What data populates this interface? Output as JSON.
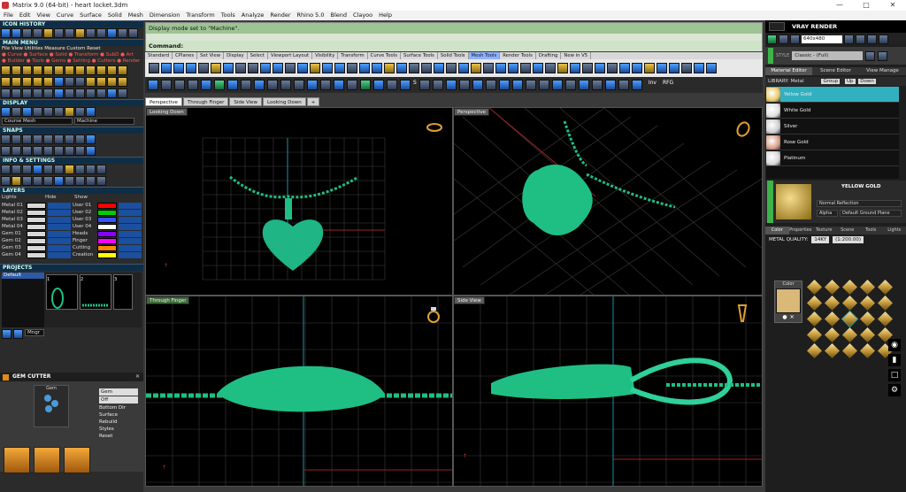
{
  "window": {
    "title": "Matrix 9.0 (64-bit) - heart locket.3dm"
  },
  "menu": [
    "File",
    "Edit",
    "View",
    "Curve",
    "Surface",
    "Solid",
    "Mesh",
    "Dimension",
    "Transform",
    "Tools",
    "Analyze",
    "Render",
    "Rhino 5.0",
    "Blend",
    "Clayoo",
    "Help"
  ],
  "left": {
    "icon_history": "ICON HISTORY",
    "main_menu": "MAIN MENU",
    "mm_row1": "File   View  Utilities  Measure  Custom        Reset",
    "mm_row2": "● Curve ● Surface ● Solid ● Transform ● SubD ● Art",
    "mm_row3": "● Builder ● Tools ● Gems ● Setting ● Cutters ● Render",
    "display": "DISPLAY",
    "display_mode_left": "Course Mesh",
    "display_mode_right": "Machine",
    "snaps": "SNAPS",
    "info_settings": "INFO & SETTINGS",
    "layers_title": "LAYERS",
    "lights": "Lights",
    "hide": "Hide",
    "show": "Show",
    "layers": [
      {
        "a": "Metal 01",
        "b": "User 01",
        "ca": "#d8d8d8",
        "cb": "#ff0000"
      },
      {
        "a": "Metal 02",
        "b": "User 02",
        "ca": "#d8d8d8",
        "cb": "#00cc00"
      },
      {
        "a": "Metal 03",
        "b": "User 03",
        "ca": "#d8d8d8",
        "cb": "#3355ff"
      },
      {
        "a": "Metal 04",
        "b": "User 04",
        "ca": "#d8d8d8",
        "cb": "#ffffff"
      },
      {
        "a": "Gem 01",
        "b": "Heads",
        "ca": "#d8d8d8",
        "cb": "#8800ff"
      },
      {
        "a": "Gem 02",
        "b": "Finger",
        "ca": "#d8d8d8",
        "cb": "#ff00ff"
      },
      {
        "a": "Gem 03",
        "b": "Cutting",
        "ca": "#d8d8d8",
        "cb": "#ff8800"
      },
      {
        "a": "Gem 04",
        "b": "Creation",
        "ca": "#d8d8d8",
        "cb": "#ffff00"
      }
    ],
    "projects": "PROJECTS",
    "project_default": "Default",
    "thumb1": "1",
    "thumb2": "2",
    "thumb3": "3",
    "mngr": "Mngr",
    "gem_cutter": "GEM CUTTER",
    "gem_label": "Gem",
    "gem_options": [
      "Gem",
      "Off",
      "Bottom Dir",
      "Surface",
      "Rebuild",
      "Styles",
      "Reset"
    ]
  },
  "command": {
    "line1": "Display mode set to \"Machine\".",
    "line2": "Command:"
  },
  "toolbar_tabs": [
    "Standard",
    "CPlanes",
    "Set View",
    "Display",
    "Select",
    "Viewport Layout",
    "Visibility",
    "Transform",
    "Curve Tools",
    "Surface Tools",
    "Solid Tools",
    "Mesh Tools",
    "Render Tools",
    "Drafting",
    "New in V5"
  ],
  "toolbar_tabs_active": "Mesh Tools",
  "toolbar2_text": {
    "s": "S",
    "inv": "Inv",
    "rfg": "RFG"
  },
  "viewport_tabs": [
    "Perspective",
    "Through Finger",
    "Side View",
    "Looking Down",
    "+"
  ],
  "viewports": {
    "top_left": "Looking Down",
    "top_right": "Perspective",
    "bottom_left": "Through Finger",
    "bottom_right": "Side View"
  },
  "vray": {
    "title": "VRAY RENDER",
    "resolution": "640x480",
    "style_label": "STYLE",
    "style_value": "Classic - (Full)",
    "tabs": [
      "Material Editor",
      "Scene Editor",
      "View Manage"
    ],
    "library": "LIBRARY: Metal",
    "library_controls": [
      "Group",
      "Up",
      "Down"
    ],
    "materials": [
      {
        "name": "Yellow Gold",
        "color": "#e8c96a"
      },
      {
        "name": "White Gold",
        "color": "#e0e0e0"
      },
      {
        "name": "Silver",
        "color": "#cfcfcf"
      },
      {
        "name": "Rose Gold",
        "color": "#d9a08a"
      },
      {
        "name": "Platinum",
        "color": "#d7d7d7"
      }
    ],
    "active_material": "Yellow Gold",
    "preview_name": "YELLOW GOLD",
    "reflection": "Normal Reflection",
    "alpha": "Alpha",
    "ground": "Default Ground Plane",
    "color_tabs": [
      "Color",
      "Properties",
      "Texture",
      "Scene",
      "Tools",
      "Lights"
    ],
    "metal_quality_label": "METAL QUALITY:",
    "metal_quality": "14KY",
    "metal_ratio": "(1:200.00)",
    "color_label": "Color"
  },
  "colors": {
    "accent": "#33b0c0",
    "object": "#1fbf84",
    "grid": "#4a4a4a"
  }
}
